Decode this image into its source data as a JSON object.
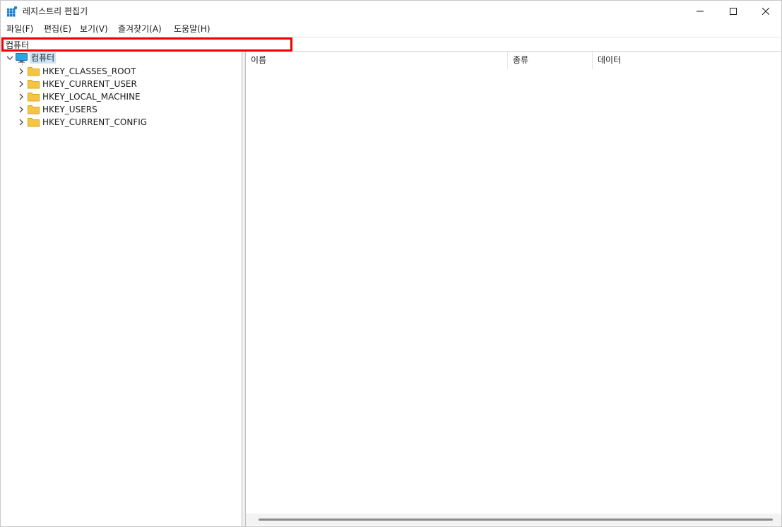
{
  "window": {
    "title": "레지스트리 편집기",
    "icon": "registry-editor-icon"
  },
  "menu": {
    "file": "파일(F)",
    "edit": "편집(E)",
    "view": "보기(V)",
    "favorites": "즐겨찾기(A)",
    "help": "도움말(H)"
  },
  "address": {
    "value": "컴퓨터"
  },
  "tree": {
    "root": "컴퓨터",
    "keys": [
      "HKEY_CLASSES_ROOT",
      "HKEY_CURRENT_USER",
      "HKEY_LOCAL_MACHINE",
      "HKEY_USERS",
      "HKEY_CURRENT_CONFIG"
    ]
  },
  "list": {
    "columns": {
      "name": "이름",
      "type": "종류",
      "data": "데이터"
    }
  },
  "colors": {
    "highlight_border": "#ee0000",
    "selection": "#cce4f7",
    "folder": "#f5c542"
  }
}
